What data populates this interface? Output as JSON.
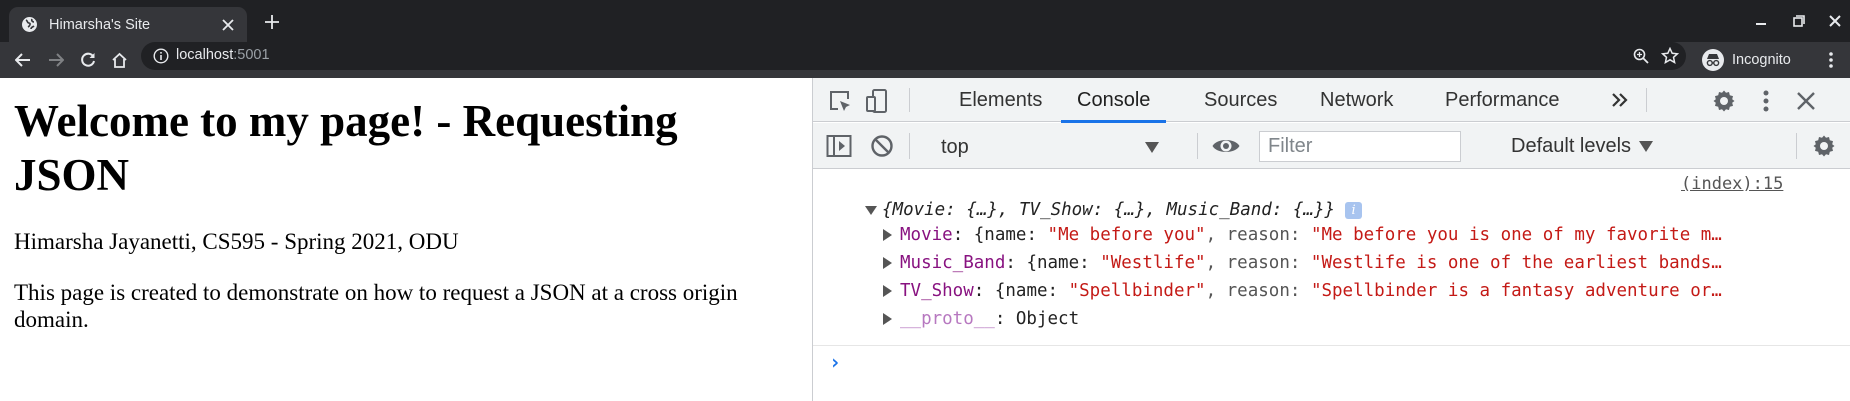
{
  "browser": {
    "tab_title": "Himarsha's Site",
    "url_host": "localhost",
    "url_port": ":5001",
    "profile_label": "Incognito",
    "colors": {
      "frame": "#202124",
      "toolbar": "#35363a",
      "text": "#e8eaed",
      "accent": "#1a73e8"
    }
  },
  "page": {
    "heading": "Welcome to my page! - Requesting JSON",
    "author_line": "Himarsha Jayanetti, CS595 - Spring 2021, ODU",
    "description": "This page is created to demonstrate on how to request a JSON at a cross origin domain."
  },
  "devtools": {
    "tabs": [
      "Elements",
      "Console",
      "Sources",
      "Network",
      "Performance"
    ],
    "active_tab": "Console",
    "more_tabs_icon": "chevron-double-right-icon",
    "context_value": "top",
    "filter_placeholder": "Filter",
    "levels_label": "Default levels",
    "console": {
      "source_link": "(index):15",
      "object_summary": "{Movie: {…}, TV_Show: {…}, Music_Band: {…}}",
      "info_badge": "i",
      "properties": [
        {
          "key": "Movie",
          "open": "{name: ",
          "name": "\"Me before you\"",
          "mid": ", reason: ",
          "reason": "\"Me before you is one of my favorite m…"
        },
        {
          "key": "Music_Band",
          "open": "{name: ",
          "name": "\"Westlife\"",
          "mid": ", reason: ",
          "reason": "\"Westlife is one of the earliest bands…"
        },
        {
          "key": "TV_Show",
          "open": "{name: ",
          "name": "\"Spellbinder\"",
          "mid": ", reason: ",
          "reason": "\"Spellbinder is a fantasy adventure or…"
        }
      ],
      "proto_key": "__proto__",
      "proto_value": ": Object",
      "prompt_symbol": "›"
    }
  }
}
